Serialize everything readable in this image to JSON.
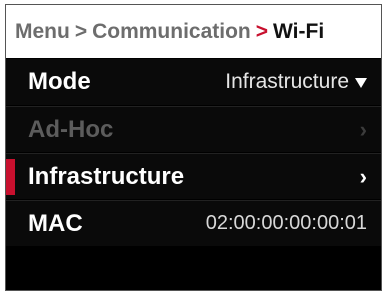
{
  "breadcrumb": {
    "menu": "Menu",
    "sep1": ">",
    "communication": "Communication",
    "sep2": ">",
    "current": "Wi-Fi"
  },
  "rows": {
    "mode": {
      "label": "Mode",
      "value": "Infrastructure",
      "icon": "chevron-down-icon"
    },
    "adhoc": {
      "label": "Ad-Hoc",
      "caret": "›",
      "state": "disabled"
    },
    "infrastructure": {
      "label": "Infrastructure",
      "caret": "›",
      "state": "selected"
    },
    "mac": {
      "label": "MAC",
      "value": "02:00:00:00:00:01"
    }
  },
  "colors": {
    "accent": "#c8102e",
    "background": "#000000",
    "text": "#ffffff",
    "disabled_text": "#5c5c5c"
  }
}
